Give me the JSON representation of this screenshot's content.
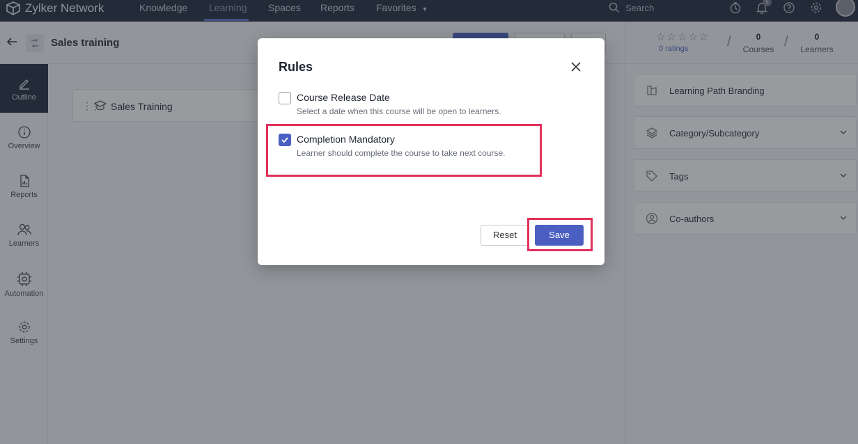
{
  "app": {
    "brand": "Zylker Network",
    "nav": [
      {
        "label": "Knowledge",
        "active": false
      },
      {
        "label": "Learning",
        "active": true
      },
      {
        "label": "Spaces",
        "active": false
      },
      {
        "label": "Reports",
        "active": false
      },
      {
        "label": "Favorites",
        "active": false
      }
    ],
    "search_label": "Search",
    "notification_count": "5"
  },
  "header": {
    "title": "Sales training",
    "ratings_text": "0 ratings",
    "courses_count": "0",
    "courses_label": "Courses",
    "learners_count": "0",
    "learners_label": "Learners"
  },
  "sidebar": {
    "items": [
      {
        "label": "Outline",
        "icon": "pencil-icon",
        "active": true
      },
      {
        "label": "Overview",
        "icon": "info-icon",
        "active": false
      },
      {
        "label": "Reports",
        "icon": "report-icon",
        "active": false
      },
      {
        "label": "Learners",
        "icon": "users-icon",
        "active": false
      },
      {
        "label": "Automation",
        "icon": "automation-icon",
        "active": false
      },
      {
        "label": "Settings",
        "icon": "gear-icon",
        "active": false
      }
    ]
  },
  "outline": {
    "item_label": "Sales Training"
  },
  "right_panel": {
    "items": [
      {
        "label": "Learning Path Branding"
      },
      {
        "label": "Category/Subcategory"
      },
      {
        "label": "Tags"
      },
      {
        "label": "Co-authors"
      }
    ]
  },
  "modal": {
    "title": "Rules",
    "rules": [
      {
        "title": "Course Release Date",
        "description": "Select a date when this course will be open to learners.",
        "checked": false
      },
      {
        "title": "Completion Mandatory",
        "description": "Learner should complete the course to take next course.",
        "checked": true
      }
    ],
    "reset_label": "Reset",
    "save_label": "Save"
  },
  "colors": {
    "nav_bg": "#1f2b3e",
    "accent": "#4a5fc1",
    "highlight": "#e0315a"
  }
}
